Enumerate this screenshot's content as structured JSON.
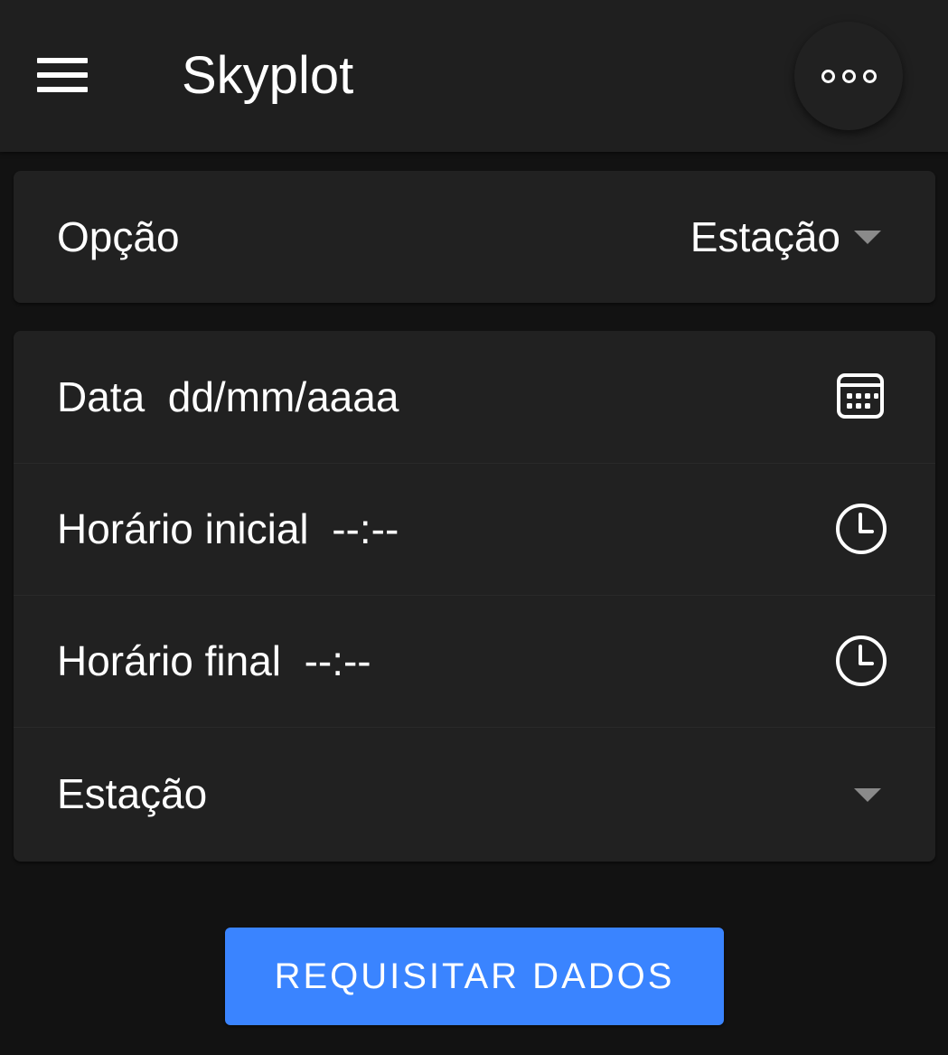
{
  "header": {
    "title": "Skyplot",
    "menu_icon": "hamburger-menu-icon",
    "more_icon": "more-horizontal-icon"
  },
  "option_card": {
    "label": "Opção",
    "selected": "Estação"
  },
  "form": {
    "date": {
      "label": "Data",
      "value": "dd/mm/aaaa",
      "icon": "calendar-icon"
    },
    "start_time": {
      "label": "Horário inicial",
      "value": "--:--",
      "icon": "clock-icon"
    },
    "end_time": {
      "label": "Horário final",
      "value": "--:--",
      "icon": "clock-icon"
    },
    "station": {
      "label": "Estação",
      "value": ""
    }
  },
  "actions": {
    "request_label": "REQUISITAR DADOS"
  },
  "colors": {
    "background": "#121212",
    "surface": "#212121",
    "accent": "#3a84ff",
    "text": "#ffffff"
  }
}
